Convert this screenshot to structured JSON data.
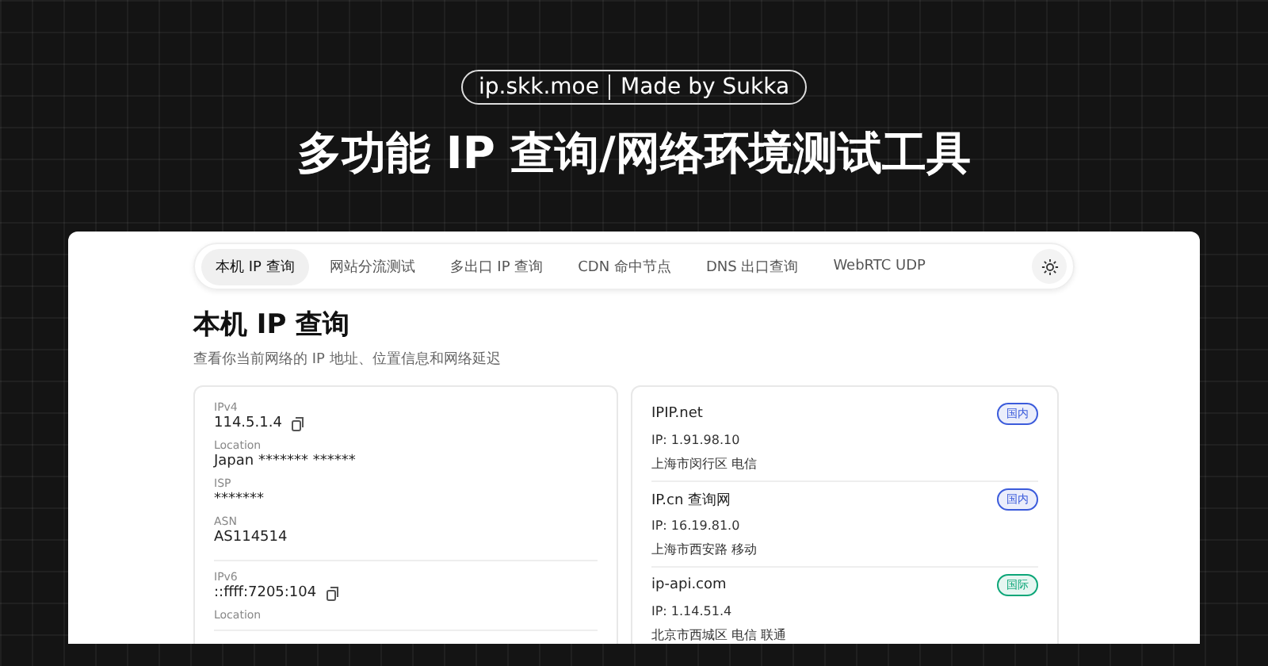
{
  "header": {
    "badge_site": "ip.skk.moe",
    "badge_author": "Made by Sukka",
    "headline": "多功能 IP 查询/网络环境测试工具"
  },
  "nav": {
    "tabs": [
      {
        "label": "本机 IP 查询",
        "selected": true
      },
      {
        "label": "网站分流测试",
        "selected": false
      },
      {
        "label": "多出口 IP 查询",
        "selected": false
      },
      {
        "label": "CDN 命中节点",
        "selected": false
      },
      {
        "label": "DNS 出口查询",
        "selected": false
      },
      {
        "label": "WebRTC UDP",
        "selected": false
      }
    ]
  },
  "page": {
    "title": "本机 IP 查询",
    "subtitle": "查看你当前网络的 IP 地址、位置信息和网络延迟"
  },
  "local_card": {
    "groups": [
      {
        "fields": [
          {
            "label": "IPv4",
            "value": "114.5.1.4",
            "copyable": true
          },
          {
            "label": "Location",
            "value": "Japan ******* ******",
            "copyable": false
          },
          {
            "label": "ISP",
            "value": "*******",
            "copyable": false
          },
          {
            "label": "ASN",
            "value": "AS114514",
            "copyable": false
          }
        ]
      },
      {
        "fields": [
          {
            "label": "IPv6",
            "value": "::ffff:7205:104",
            "copyable": true
          },
          {
            "label": "Location"
          }
        ]
      }
    ]
  },
  "sources": [
    {
      "name": "IPIP.net",
      "tag": "国内",
      "color": "#3b5bdb",
      "ip": "IP: 1.91.98.10",
      "location": "上海市闵行区 电信"
    },
    {
      "name": "IP.cn 查询网",
      "tag": "国内",
      "color": "#3b5bdb",
      "ip": "IP: 16.19.81.0",
      "location": "上海市西安路 移动"
    },
    {
      "name": "ip-api.com",
      "tag": "国际",
      "color": "#0ca678",
      "ip": "IP: 1.14.51.4",
      "location": "北京市西城区 电信 联通"
    }
  ]
}
